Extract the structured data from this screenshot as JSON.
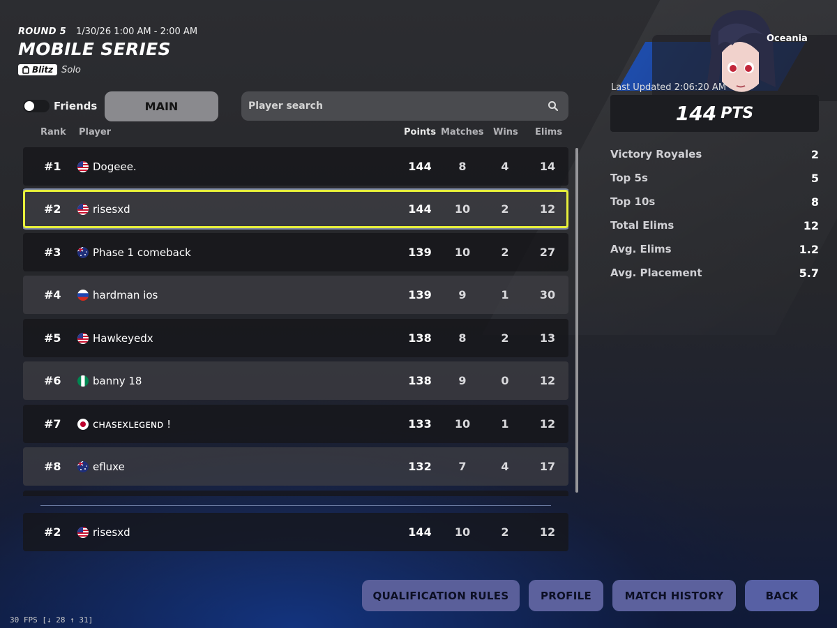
{
  "header": {
    "round": "ROUND 5",
    "datetime": "1/30/26 1:00 AM - 2:00 AM",
    "title": "MOBILE SERIES",
    "mode_badge": "Blitz",
    "mode_type": "Solo"
  },
  "filters": {
    "friends_label": "Friends",
    "friends_toggle_on": false,
    "main_tab": "MAIN",
    "search_placeholder": "Player search"
  },
  "columns": {
    "rank": "Rank",
    "player": "Player",
    "points": "Points",
    "matches": "Matches",
    "wins": "Wins",
    "elims": "Elims"
  },
  "leaderboard": [
    {
      "rank": "#1",
      "player": "Dogeee.",
      "flag": "us",
      "points": "144",
      "matches": "8",
      "wins": "4",
      "elims": "14"
    },
    {
      "rank": "#2",
      "player": "risesxd",
      "flag": "us",
      "points": "144",
      "matches": "10",
      "wins": "2",
      "elims": "12"
    },
    {
      "rank": "#3",
      "player": "Phase 1 comeback",
      "flag": "au",
      "points": "139",
      "matches": "10",
      "wins": "2",
      "elims": "27"
    },
    {
      "rank": "#4",
      "player": "hardman ios",
      "flag": "ru",
      "points": "139",
      "matches": "9",
      "wins": "1",
      "elims": "30"
    },
    {
      "rank": "#5",
      "player": "Hawkeyedx",
      "flag": "us",
      "points": "138",
      "matches": "8",
      "wins": "2",
      "elims": "13"
    },
    {
      "rank": "#6",
      "player": "banny 18",
      "flag": "ng",
      "points": "138",
      "matches": "9",
      "wins": "0",
      "elims": "12"
    },
    {
      "rank": "#7",
      "player": "ᴄʜᴀsᴇxʟᴇɢᴇɴᴅ !",
      "flag": "jp",
      "points": "133",
      "matches": "10",
      "wins": "1",
      "elims": "12"
    },
    {
      "rank": "#8",
      "player": "efluxe",
      "flag": "au",
      "points": "132",
      "matches": "7",
      "wins": "4",
      "elims": "17"
    }
  ],
  "self_row": {
    "rank": "#2",
    "player": "risesxd",
    "flag": "us",
    "points": "144",
    "matches": "10",
    "wins": "2",
    "elims": "12"
  },
  "profile": {
    "region": "Oceania",
    "last_updated": "Last Updated 2:06:20 AM",
    "points_value": "144",
    "points_unit": "PTS",
    "stats": [
      {
        "label": "Victory Royales",
        "value": "2"
      },
      {
        "label": "Top 5s",
        "value": "5"
      },
      {
        "label": "Top 10s",
        "value": "8"
      },
      {
        "label": "Total Elims",
        "value": "12"
      },
      {
        "label": "Avg. Elims",
        "value": "1.2"
      },
      {
        "label": "Avg. Placement",
        "value": "5.7"
      }
    ]
  },
  "buttons": {
    "qualification_rules": "QUALIFICATION RULES",
    "profile": "PROFILE",
    "match_history": "MATCH HISTORY",
    "back": "BACK"
  },
  "debug": {
    "fps": "30 FPS [↓ 28 ↑ 31]"
  },
  "colors": {
    "selection_border": "#e8f03b",
    "button_bg": "#5c619d",
    "main_tab_bg": "#8a8a8e"
  },
  "icons": {
    "search": "search-icon",
    "blitz": "blitz-icon"
  }
}
